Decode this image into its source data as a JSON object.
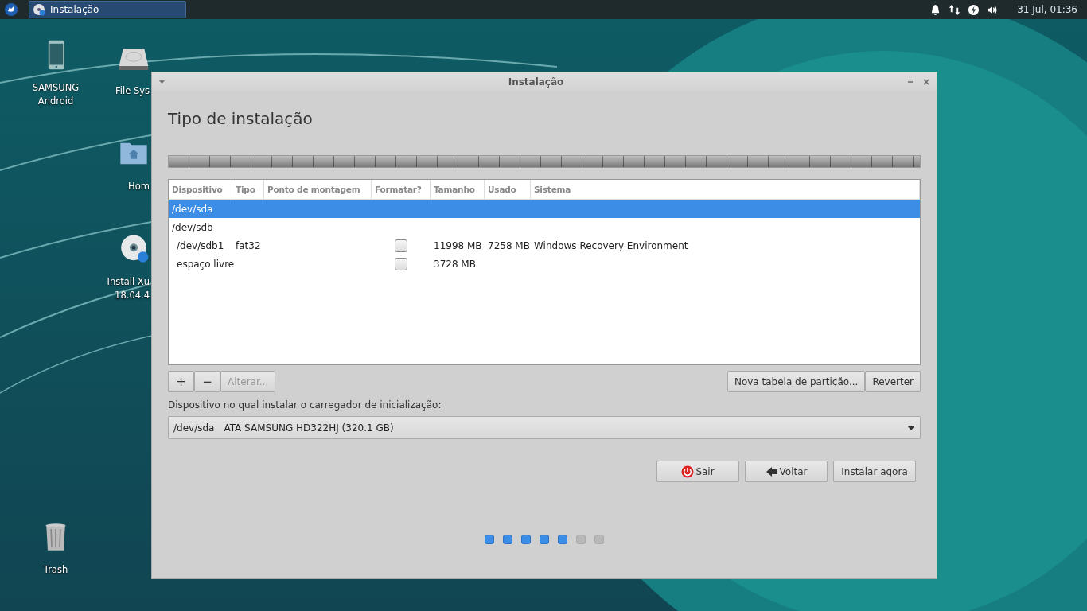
{
  "panel": {
    "task": {
      "label": "Instalação",
      "selected": true
    },
    "clock": "31 Jul, 01:36"
  },
  "desktop_icons": [
    {
      "kind": "phone",
      "lines": [
        "SAMSUNG",
        "Android"
      ]
    },
    {
      "kind": "drive",
      "lines": [
        "File Sys"
      ]
    },
    {
      "kind": "home",
      "lines": [
        "Hom"
      ]
    },
    {
      "kind": "disc",
      "lines": [
        "Install Xu",
        "18.04.4"
      ]
    },
    {
      "kind": "trash",
      "lines": [
        "Trash"
      ]
    }
  ],
  "window": {
    "title": "Instalação",
    "heading": "Tipo de instalação",
    "table": {
      "columns": [
        "Dispositivo",
        "Tipo",
        "Ponto de montagem",
        "Formatar?",
        "Tamanho",
        "Usado",
        "Sistema"
      ],
      "rows": [
        {
          "device": "/dev/sda",
          "selected": true
        },
        {
          "device": "/dev/sdb",
          "selected": false,
          "children": [
            {
              "device": "/dev/sdb1",
              "type": "fat32",
              "format": false,
              "size": "11998 MB",
              "used": "7258 MB",
              "system": "Windows Recovery Environment",
              "selected": false
            },
            {
              "device": "espaço livre",
              "format": false,
              "size": "3728 MB",
              "selected": false
            }
          ]
        }
      ]
    },
    "table_buttons": [
      {
        "label": "+",
        "disabled": false
      },
      {
        "label": "−",
        "disabled": false
      },
      {
        "label": "Alterar...",
        "disabled": true
      }
    ],
    "right_buttons": [
      "Nova tabela de partição...",
      "Reverter"
    ],
    "bootloader_label": "Dispositivo no qual instalar o carregador de inicialização:",
    "bootloader": {
      "device": "/dev/sda",
      "description": "ATA SAMSUNG HD322HJ (320.1 GB)"
    },
    "actions": [
      {
        "kind": "quit",
        "label": "Sair"
      },
      {
        "kind": "back",
        "label": "Voltar"
      },
      {
        "kind": "plain",
        "label": "Instalar agora"
      }
    ],
    "steps": [
      {
        "done": true
      },
      {
        "done": true
      },
      {
        "done": true
      },
      {
        "done": true
      },
      {
        "done": true
      },
      {
        "done": false
      },
      {
        "done": false
      }
    ]
  }
}
